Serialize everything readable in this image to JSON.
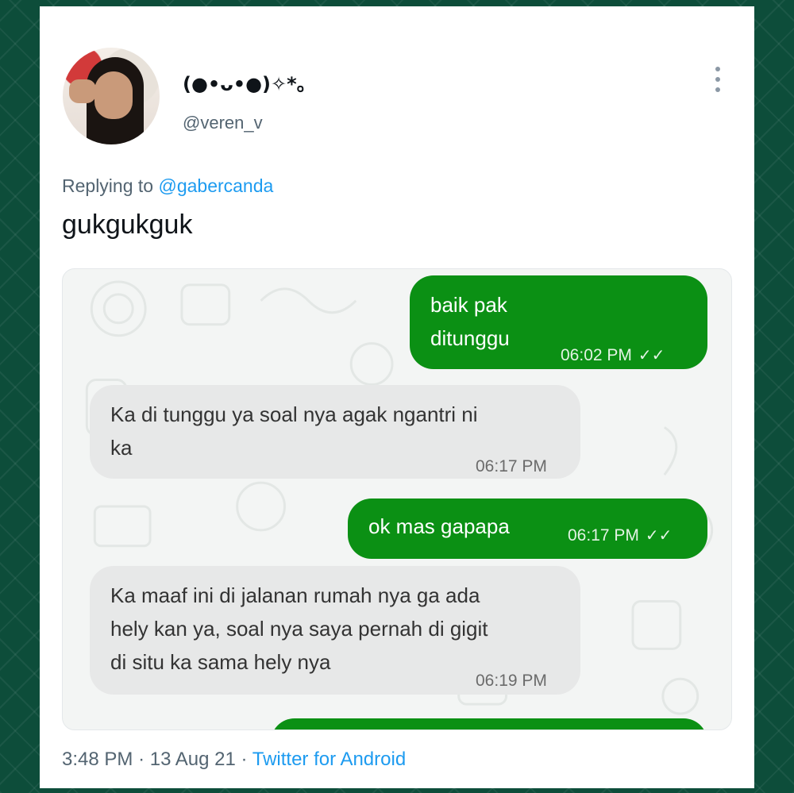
{
  "tweet": {
    "display_name": "(●•ᴗ•●)✧*。",
    "username": "@veren_v",
    "replying_prefix": "Replying to",
    "replying_handle": "@gabercanda",
    "text": "gukgukguk",
    "time": "3:48 PM",
    "separator": "·",
    "date": "13 Aug 21",
    "source": "Twitter for Android",
    "more_icon": "more-vertical-icon"
  },
  "chat": {
    "messages": [
      {
        "direction": "outgoing",
        "text": "baik pak\nditunggu",
        "time": "06:02 PM",
        "status_icon": "double-check-icon"
      },
      {
        "direction": "incoming",
        "text": "Ka di tunggu ya soal nya agak ngantri ni\nka",
        "time": "06:17 PM"
      },
      {
        "direction": "outgoing",
        "text": "ok mas gapapa",
        "time": "06:17 PM",
        "status_icon": "double-check-icon"
      },
      {
        "direction": "incoming",
        "text": "Ka maaf ini di jalanan rumah nya ga ada\nhely kan ya, soal nya saya pernah di gigit\ndi situ ka sama hely nya",
        "time": "06:19 PM"
      }
    ]
  },
  "colors": {
    "outgoing_bubble": "#0b9014",
    "incoming_bubble": "#e7e8e8",
    "link": "#1d9bf0",
    "page_background": "#0d4d3a"
  }
}
